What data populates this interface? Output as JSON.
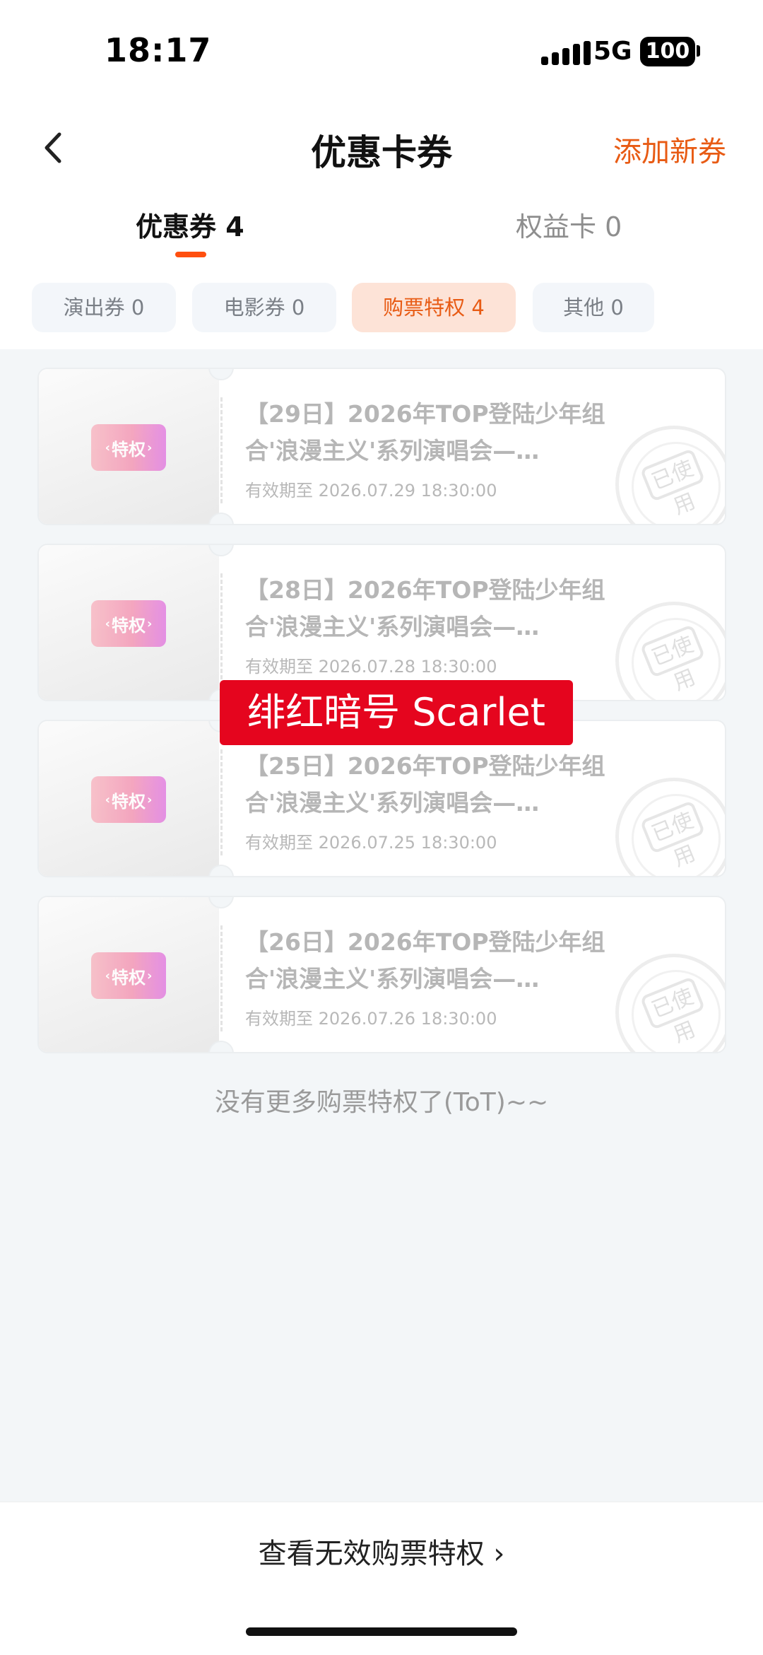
{
  "status": {
    "time": "18:17",
    "network": "5G",
    "battery": "100"
  },
  "header": {
    "title": "优惠卡券",
    "add_label": "添加新券"
  },
  "tabs": [
    {
      "label": "优惠券 4",
      "active": true
    },
    {
      "label": "权益卡 0",
      "active": false
    }
  ],
  "chips": [
    {
      "label": "演出券 0"
    },
    {
      "label": "电影券 0"
    },
    {
      "label": "购票特权 4"
    },
    {
      "label": "其他 0"
    }
  ],
  "badge_text": "特权",
  "stamp_text": "已使用",
  "cards": [
    {
      "title": "【29日】2026年TOP登陆少年组合'浪漫主义'系列演唱会—…",
      "expiry": "有效期至 2026.07.29 18:30:00"
    },
    {
      "title": "【28日】2026年TOP登陆少年组合'浪漫主义'系列演唱会—…",
      "expiry": "有效期至 2026.07.28 18:30:00"
    },
    {
      "title": "【25日】2026年TOP登陆少年组合'浪漫主义'系列演唱会—…",
      "expiry": "有效期至 2026.07.25 18:30:00"
    },
    {
      "title": "【26日】2026年TOP登陆少年组合'浪漫主义'系列演唱会—…",
      "expiry": "有效期至 2026.07.26 18:30:00"
    }
  ],
  "end_text": "没有更多购票特权了(ToT)~~",
  "watermark": "绯红暗号 Scarlet",
  "bottom_link": "查看无效购票特权 ›",
  "colors": {
    "accent": "#e85b14",
    "indicator": "#ff4f0f",
    "watermark_bg": "#e5051e"
  }
}
